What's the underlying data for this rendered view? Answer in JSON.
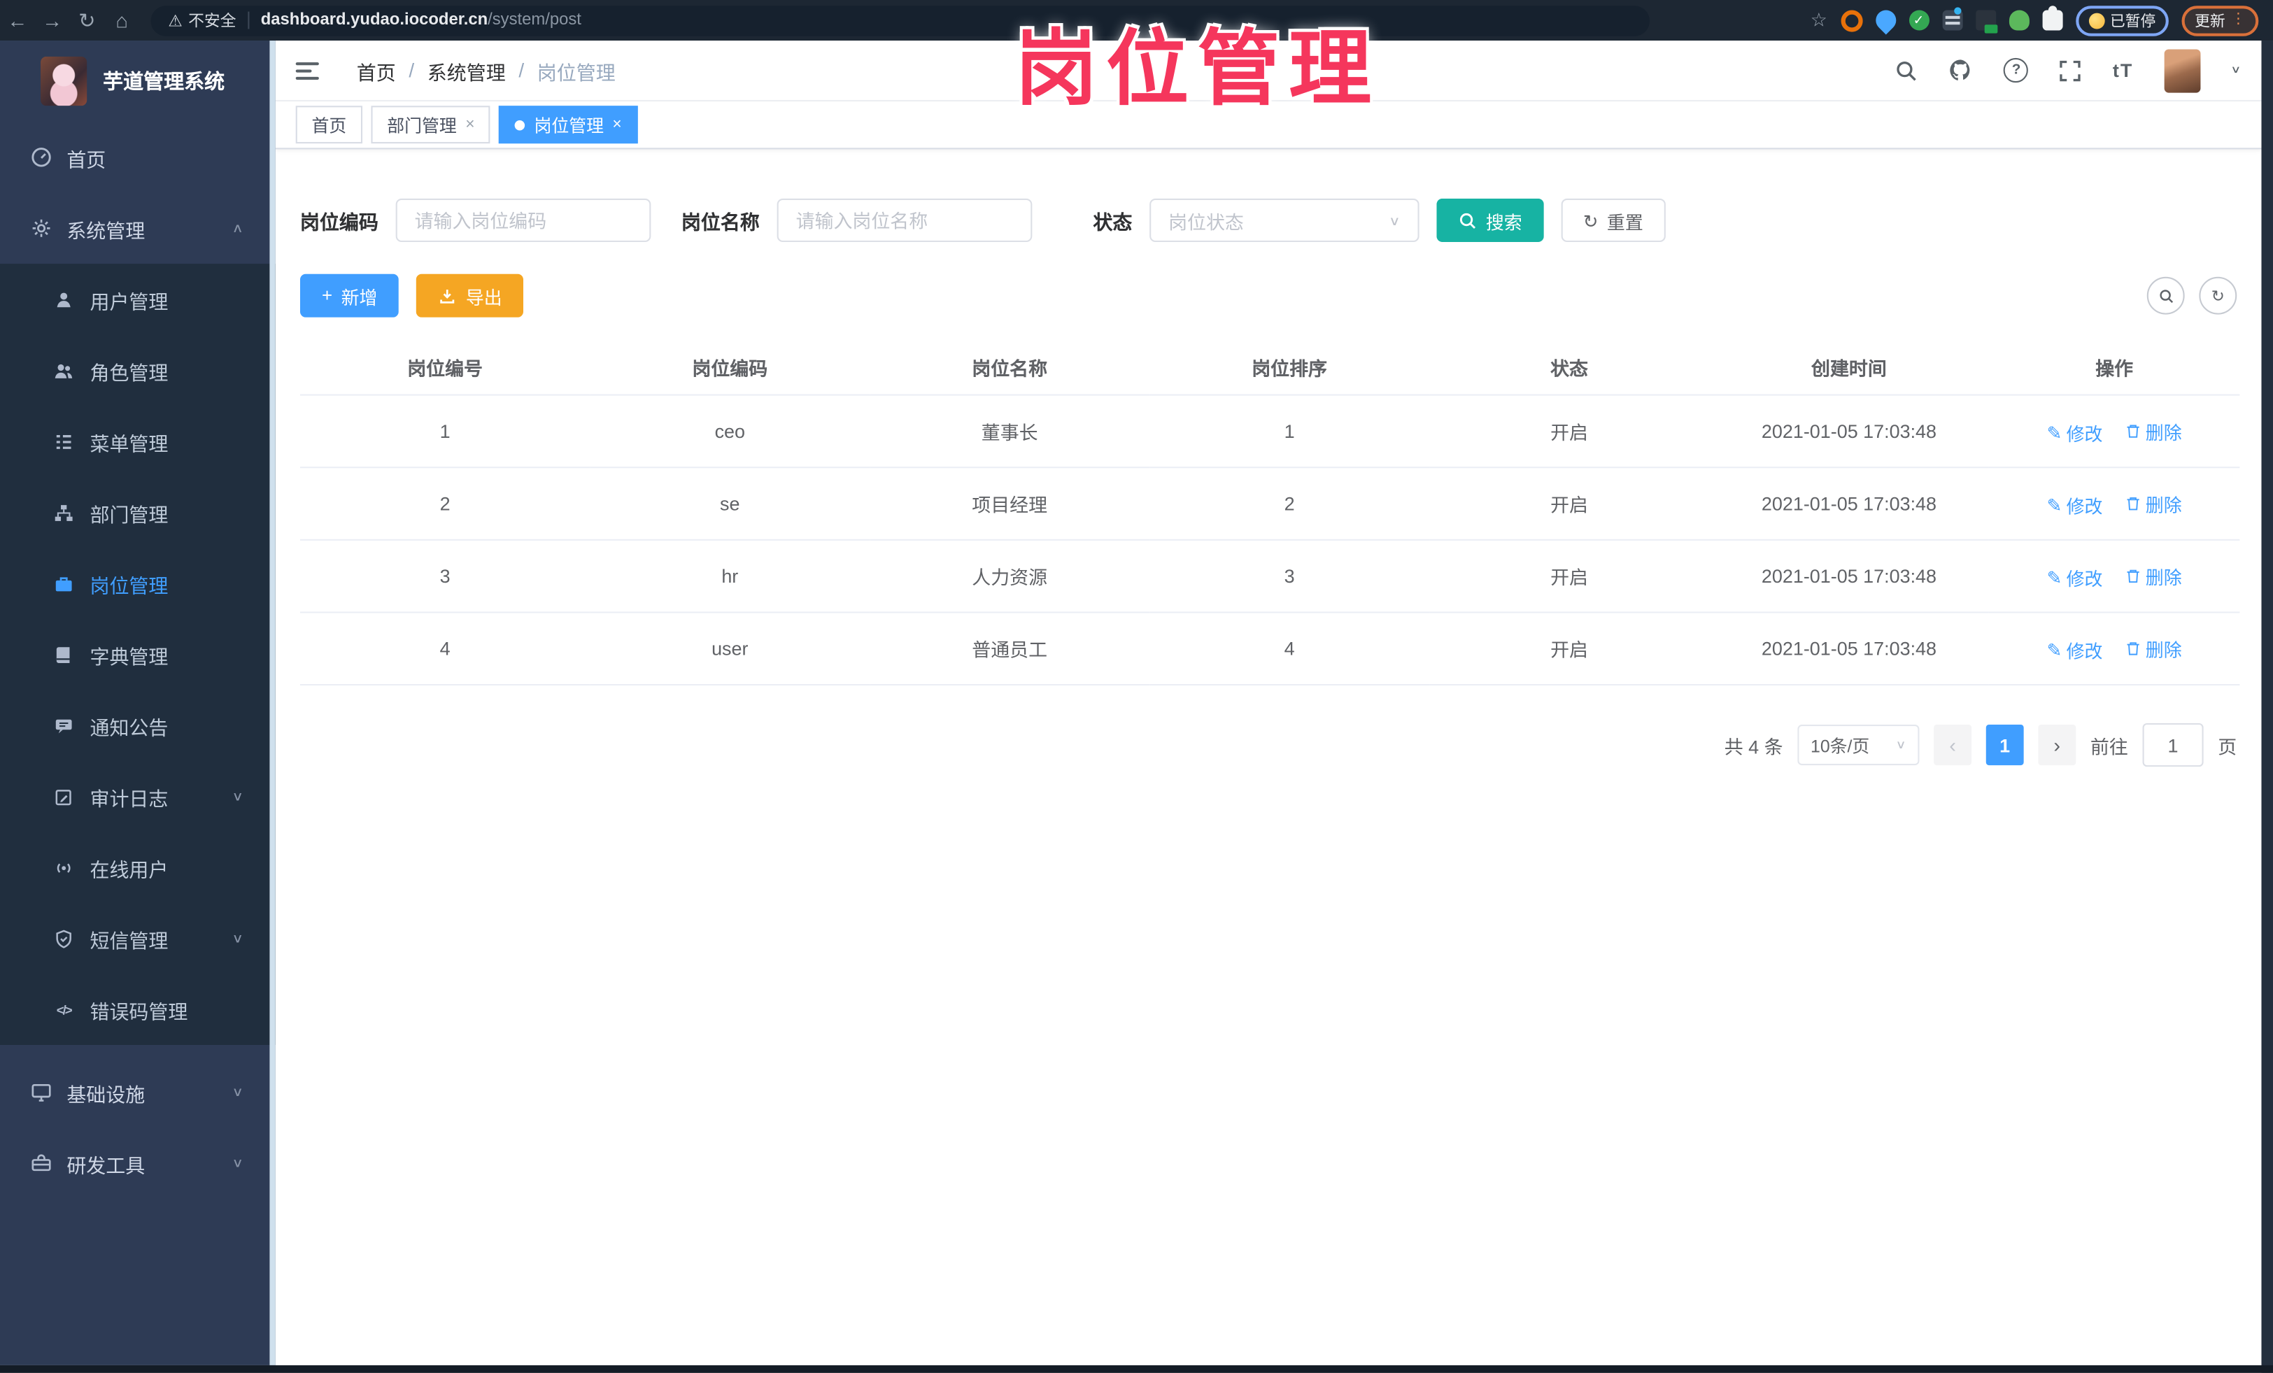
{
  "browser": {
    "security_label": "不安全",
    "url_domain": "dashboard.yudao.iocoder.cn",
    "url_path": "/system/post",
    "paused_button": "已暂停",
    "update_button": "更新"
  },
  "overlay_title": "岗位管理",
  "app_title": "芋道管理系统",
  "sidebar": {
    "top_items": [
      {
        "label": "首页"
      },
      {
        "label": "系统管理"
      }
    ],
    "submenu": [
      "用户管理",
      "角色管理",
      "菜单管理",
      "部门管理",
      "岗位管理",
      "字典管理",
      "通知公告",
      "审计日志",
      "在线用户",
      "短信管理",
      "错误码管理"
    ],
    "bottom_items": [
      {
        "label": "基础设施"
      },
      {
        "label": "研发工具"
      }
    ],
    "active_item": "岗位管理"
  },
  "breadcrumb": [
    "首页",
    "系统管理",
    "岗位管理"
  ],
  "tabs": [
    {
      "label": "首页",
      "active": "false"
    },
    {
      "label": "部门管理",
      "active": "false"
    },
    {
      "label": "岗位管理",
      "active": "true"
    }
  ],
  "filters": {
    "post_code_label": "岗位编码",
    "post_code_placeholder": "请输入岗位编码",
    "post_name_label": "岗位名称",
    "post_name_placeholder": "请输入岗位名称",
    "status_label": "状态",
    "status_placeholder": "岗位状态",
    "search_label": "搜索",
    "reset_label": "重置"
  },
  "toolbar": {
    "add_label": "新增",
    "export_label": "导出"
  },
  "table": {
    "headers": [
      "岗位编号",
      "岗位编码",
      "岗位名称",
      "岗位排序",
      "状态",
      "创建时间",
      "操作"
    ],
    "rows": [
      [
        "1",
        "ceo",
        "董事长",
        "1",
        "开启",
        "2021-01-05 17:03:48"
      ],
      [
        "2",
        "se",
        "项目经理",
        "2",
        "开启",
        "2021-01-05 17:03:48"
      ],
      [
        "3",
        "hr",
        "人力资源",
        "3",
        "开启",
        "2021-01-05 17:03:48"
      ],
      [
        "4",
        "user",
        "普通员工",
        "4",
        "开启",
        "2021-01-05 17:03:48"
      ]
    ],
    "edit_label": "修改",
    "delete_label": "删除"
  },
  "pagination": {
    "total": "共 4 条",
    "page_size": "10条/页",
    "page": "1",
    "goto_label": "前往",
    "goto_value": "1",
    "unit_label": "页"
  },
  "icons": {
    "back": "←",
    "forward": "→",
    "reload": "↻",
    "home": "⌂",
    "warning": "⚠",
    "star": "☆",
    "kebab": "⋮",
    "chevron_up": "∧",
    "chevron_down": "∨",
    "breadcrumb_sep": "/",
    "select_caret": "∨",
    "prev": "‹",
    "next": "›",
    "font_size": "tT",
    "question": "?",
    "code": "</>",
    "edit": "✎",
    "plus": "+",
    "refresh": "↻",
    "close": "×",
    "check": "✓"
  },
  "colors": {
    "accent": "#409eff",
    "search_button": "#17b3a3",
    "export_button": "#f5a623",
    "overlay_title": "#f5365c",
    "sidebar_bg": "#2e3b55",
    "submenu_bg": "#202e3e",
    "chrome_bg": "#1d2733"
  }
}
